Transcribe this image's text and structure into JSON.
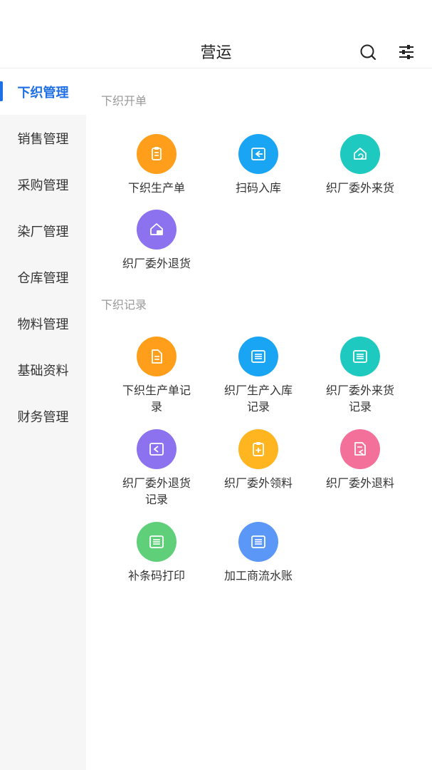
{
  "header": {
    "title": "营运"
  },
  "sidebar": {
    "items": [
      {
        "label": "下织管理",
        "active": true
      },
      {
        "label": "销售管理"
      },
      {
        "label": "采购管理"
      },
      {
        "label": "染厂管理"
      },
      {
        "label": "仓库管理"
      },
      {
        "label": "物料管理"
      },
      {
        "label": "基础资料"
      },
      {
        "label": "财务管理"
      }
    ]
  },
  "main": {
    "sections": [
      {
        "title": "下织开单",
        "items": [
          {
            "label": "下织生产单",
            "icon": "clipboard-icon",
            "color": "#ff9e1b"
          },
          {
            "label": "扫码入库",
            "icon": "scan-in-icon",
            "color": "#1aa5f4"
          },
          {
            "label": "织厂委外来货",
            "icon": "house-return-icon",
            "color": "#1ec9c0"
          },
          {
            "label": "织厂委外退货",
            "icon": "house-refund-icon",
            "color": "#8c72ef"
          }
        ]
      },
      {
        "title": "下织记录",
        "items": [
          {
            "label": "下织生产单记\n录",
            "icon": "document-icon",
            "color": "#ff9e1b"
          },
          {
            "label": "织厂生产入库\n记录",
            "icon": "list-icon",
            "color": "#1aa5f4"
          },
          {
            "label": "织厂委外来货\n记录",
            "icon": "list-icon",
            "color": "#1ec9c0"
          },
          {
            "label": "织厂委外退货\n记录",
            "icon": "return-icon",
            "color": "#8c72ef"
          },
          {
            "label": "织厂委外领料",
            "icon": "clipboard-plus-icon",
            "color": "#ffb51f"
          },
          {
            "label": "织厂委外退料",
            "icon": "document-return-icon",
            "color": "#f2709a"
          },
          {
            "label": "补条码打印",
            "icon": "list-icon",
            "color": "#5fcf79"
          },
          {
            "label": "加工商流水账",
            "icon": "list-icon",
            "color": "#5a97f6"
          }
        ]
      }
    ]
  }
}
